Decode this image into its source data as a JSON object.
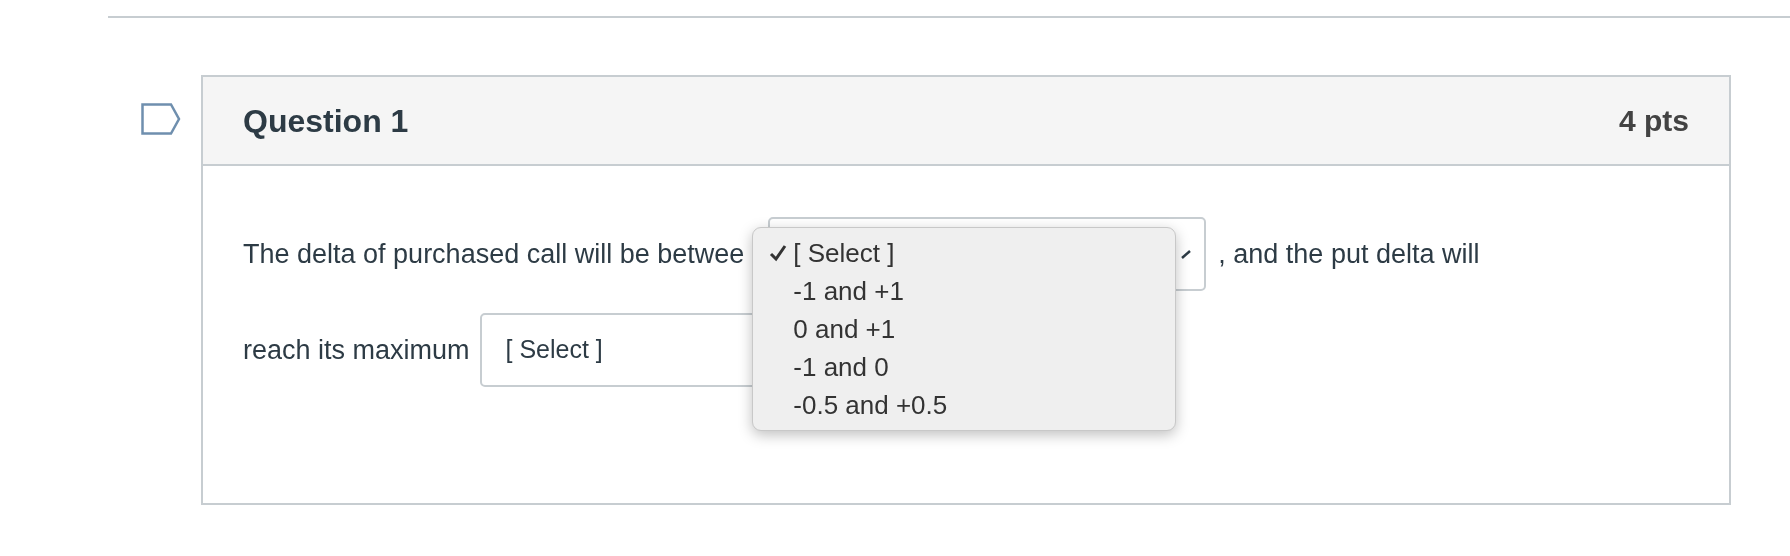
{
  "question": {
    "title": "Question 1",
    "points": "4 pts",
    "text_before": "The delta of purchased call will be betwee",
    "text_after": ", and the put delta will",
    "line_2": "reach its maximum",
    "second_select": {
      "value": "[ Select ]"
    }
  },
  "dropdown_menu": {
    "options": [
      {
        "label": "[ Select ]",
        "selected": true
      },
      {
        "label": "-1 and +1",
        "selected": false
      },
      {
        "label": "0 and +1",
        "selected": false
      },
      {
        "label": "-1 and 0",
        "selected": false
      },
      {
        "label": "-0.5 and +0.5",
        "selected": false
      }
    ]
  }
}
